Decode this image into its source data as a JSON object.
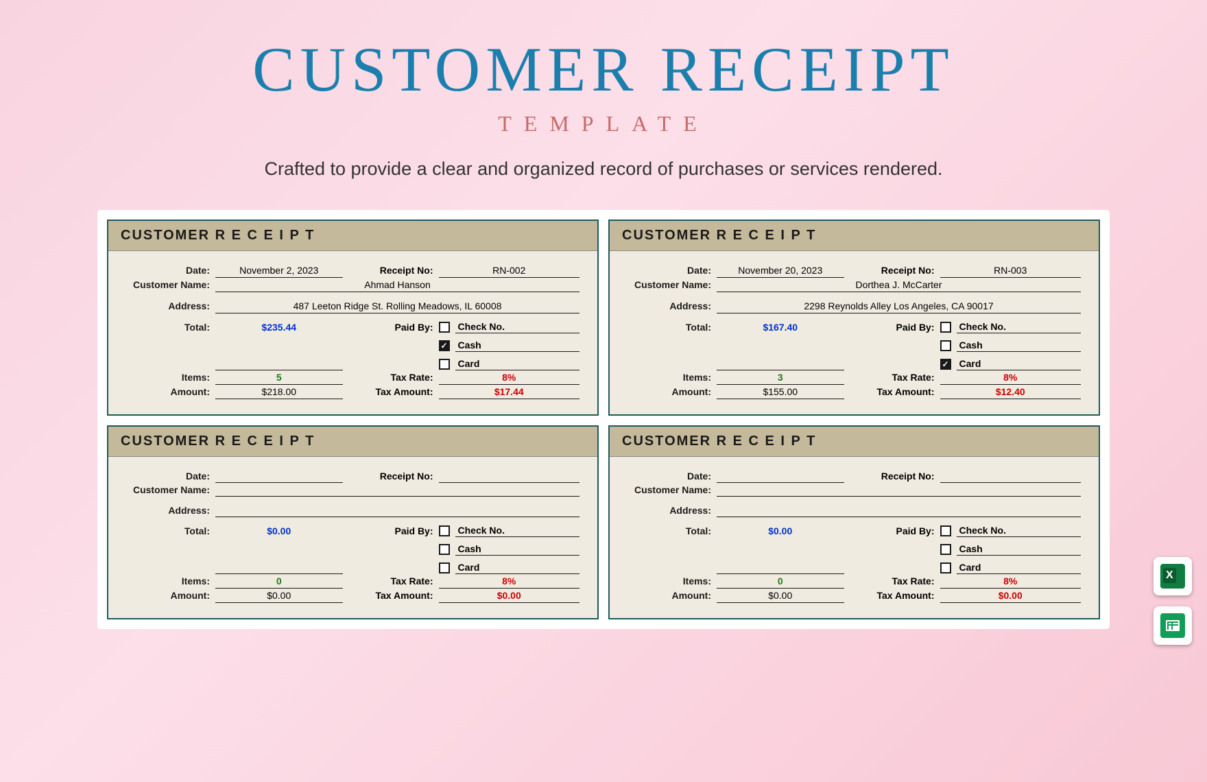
{
  "hero": {
    "title": "CUSTOMER RECEIPT",
    "subtitle": "TEMPLATE",
    "desc": "Crafted to provide a clear and organized record of purchases or services rendered."
  },
  "labels": {
    "header": "CUSTOMER  R E C E I P T",
    "date": "Date:",
    "receiptno": "Receipt No:",
    "customer": "Customer Name:",
    "address": "Address:",
    "total": "Total:",
    "paidby": "Paid By:",
    "items": "Items:",
    "taxrate": "Tax Rate:",
    "amount": "Amount:",
    "taxamount": "Tax Amount:",
    "checkno": "Check No.",
    "cash": "Cash",
    "card": "Card"
  },
  "receipts": [
    {
      "date": "November 2, 2023",
      "receiptno": "RN-002",
      "customer": "Ahmad Hanson",
      "address": "487 Leeton Ridge St. Rolling Meadows, IL 60008",
      "total": "$235.44",
      "items": "5",
      "taxrate": "8%",
      "amount": "$218.00",
      "taxamount": "$17.44",
      "paid": {
        "check": false,
        "cash": true,
        "card": false
      }
    },
    {
      "date": "November 20, 2023",
      "receiptno": "RN-003",
      "customer": "Dorthea J. McCarter",
      "address": "2298 Reynolds Alley Los Angeles, CA 90017",
      "total": "$167.40",
      "items": "3",
      "taxrate": "8%",
      "amount": "$155.00",
      "taxamount": "$12.40",
      "paid": {
        "check": false,
        "cash": false,
        "card": true
      }
    },
    {
      "date": "",
      "receiptno": "",
      "customer": "",
      "address": "",
      "total": "$0.00",
      "items": "0",
      "taxrate": "8%",
      "amount": "$0.00",
      "taxamount": "$0.00",
      "paid": {
        "check": false,
        "cash": false,
        "card": false
      }
    },
    {
      "date": "",
      "receiptno": "",
      "customer": "",
      "address": "",
      "total": "$0.00",
      "items": "0",
      "taxrate": "8%",
      "amount": "$0.00",
      "taxamount": "$0.00",
      "paid": {
        "check": false,
        "cash": false,
        "card": false
      }
    }
  ],
  "badges": {
    "excel": "Excel",
    "sheets": "Google Sheets"
  }
}
